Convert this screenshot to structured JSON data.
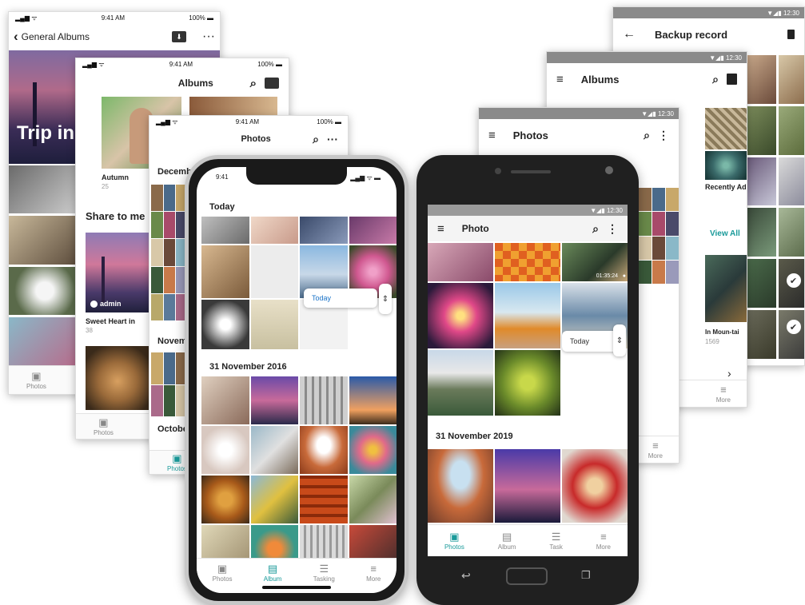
{
  "ios_status": {
    "time": "9:41 AM",
    "battery": "100%",
    "phone_time": "9:41"
  },
  "android_status": {
    "time": "12:30"
  },
  "general_albums": {
    "back_label": "General Albums",
    "hero_title": "Trip in",
    "tab_label": "Photos"
  },
  "albums_ios": {
    "title": "Albums",
    "album_name": "Autumn",
    "album_count": "25",
    "shared_heading": "Share to me",
    "shared_owner": "admin",
    "shared_album_name": "Sweet Heart in",
    "shared_album_count": "38",
    "tab_label": "Photos"
  },
  "photos_ios_back": {
    "title": "Photos",
    "sections": [
      "December",
      "Novem",
      "October"
    ],
    "tab_label": "Photos"
  },
  "iphone": {
    "today_label": "Today",
    "timeline_label": "Today",
    "section_2": "31 November 2016",
    "tabs": [
      {
        "label": "Photos",
        "icon": "photos-icon",
        "active": false
      },
      {
        "label": "Album",
        "icon": "album-icon",
        "active": true
      },
      {
        "label": "Tasking",
        "icon": "task-icon",
        "active": false
      },
      {
        "label": "More",
        "icon": "more-icon",
        "active": false
      }
    ]
  },
  "android_phone": {
    "title": "Photo",
    "video_duration": "01:35:24",
    "timeline_label": "Today",
    "section_2": "31 November 2019",
    "tabs": [
      {
        "label": "Photos",
        "icon": "photos-icon",
        "active": true
      },
      {
        "label": "Album",
        "icon": "album-icon",
        "active": false
      },
      {
        "label": "Task",
        "icon": "task-icon",
        "active": false
      },
      {
        "label": "More",
        "icon": "more-icon",
        "active": false
      }
    ]
  },
  "photos_android_back": {
    "title": "Photos",
    "tab_label": "More"
  },
  "albums_android": {
    "title": "Albums",
    "recently_added": "Recently Ad",
    "view_all": "View All",
    "album_name": "In Moun-tai",
    "album_count": "1569",
    "tab_label": "More"
  },
  "backup_record": {
    "title": "Backup record"
  },
  "colors": {
    "accent": "#1a9a9a",
    "link": "#1a73c8",
    "android_bar": "#8a8a8a"
  }
}
